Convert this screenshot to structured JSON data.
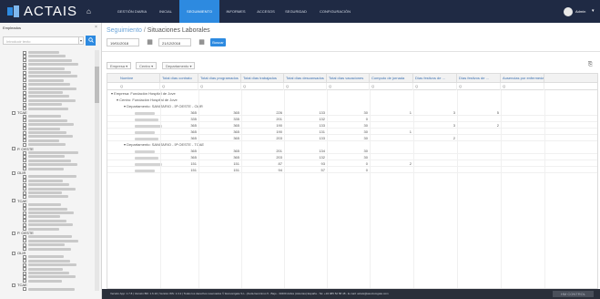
{
  "app": {
    "logo_text": "ACTAIS"
  },
  "nav": [
    {
      "label": "GESTIÓN DIARIA"
    },
    {
      "label": "INICIAL"
    },
    {
      "label": "SEGUIMIENTO"
    },
    {
      "label": "INFORMES"
    },
    {
      "label": "ACCESOS"
    },
    {
      "label": "SEGURIDAD"
    },
    {
      "label": "CONFIGURACIÓN"
    }
  ],
  "user": {
    "name": "Admin"
  },
  "sidebar": {
    "title": "Empleados",
    "search_placeholder": "Introducir texto",
    "tree_labels": [
      "TCAE",
      "P. OESTE",
      "OLIR",
      "TCAE",
      "P. OESTE",
      "OLIR",
      "TCAE"
    ]
  },
  "breadcrumb": {
    "section": "Seguimiento",
    "separator": " / ",
    "page": "Situaciones Laborales"
  },
  "filters": {
    "date_from": "19/01/2018",
    "date_to": "21/12/2018",
    "search_label": "Buscar"
  },
  "grouping": {
    "chips": [
      "Empresa",
      "Centro",
      "Departamento"
    ]
  },
  "grid": {
    "columns": [
      "Nombre",
      "Total días contrato",
      "Total días programados",
      "Total días trabajados",
      "Total días descansados",
      "Total días vacaciones",
      "Computo de jornada",
      "Días festivos de ...",
      "Días festivos de ...",
      "Ausencias por enfermedad"
    ],
    "filter_symbol": "Q",
    "groups": {
      "company": "Empresa: Fundación Hospital de Jove",
      "center": "Centro: Fundación Hospital de Jove",
      "dept1": "Departamento: SANITARIO - 5ª OESTE - OLIR",
      "dept2": "Departamento: SANITARIO - 5ª OESTE - TCAE"
    },
    "rows_dept1": [
      [
        "365",
        "365",
        "226",
        "133",
        "30",
        "1",
        "3",
        "5"
      ],
      [
        "335",
        "335",
        "201",
        "132",
        "0",
        "",
        "",
        ""
      ],
      [
        "365",
        "365",
        "190",
        "133",
        "30",
        "",
        "3",
        "2"
      ],
      [
        "365",
        "365",
        "190",
        "131",
        "30",
        "1",
        "",
        ""
      ],
      [
        "365",
        "365",
        "203",
        "133",
        "30",
        "",
        "2",
        ""
      ]
    ],
    "rows_dept2": [
      [
        "365",
        "365",
        "201",
        "134",
        "30",
        "",
        "",
        ""
      ],
      [
        "365",
        "365",
        "203",
        "132",
        "30",
        "",
        "",
        ""
      ],
      [
        "151",
        "151",
        "87",
        "93",
        "0",
        "2",
        "",
        ""
      ],
      [
        "151",
        "151",
        "94",
        "57",
        "0",
        "",
        "",
        ""
      ]
    ]
  },
  "footer": {
    "text": "Versión App: 1.7.8 | Versión BD: 1.6.10 | Versión WS: 1.3.2 | Todos los derechos reservados © Escuonigate S.L. (Avda.Gerónimo 5 - Bajo - 33400 Avilés (Asturias) España - Tel. +34 985 52 58 48 - E-mail: actais@asociomgate.com",
    "logo": "HM CONTROL"
  },
  "colors": {
    "nav_bg": "#1f2a44",
    "accent": "#2d8ae0",
    "footer_bg": "#2a2f3a"
  }
}
